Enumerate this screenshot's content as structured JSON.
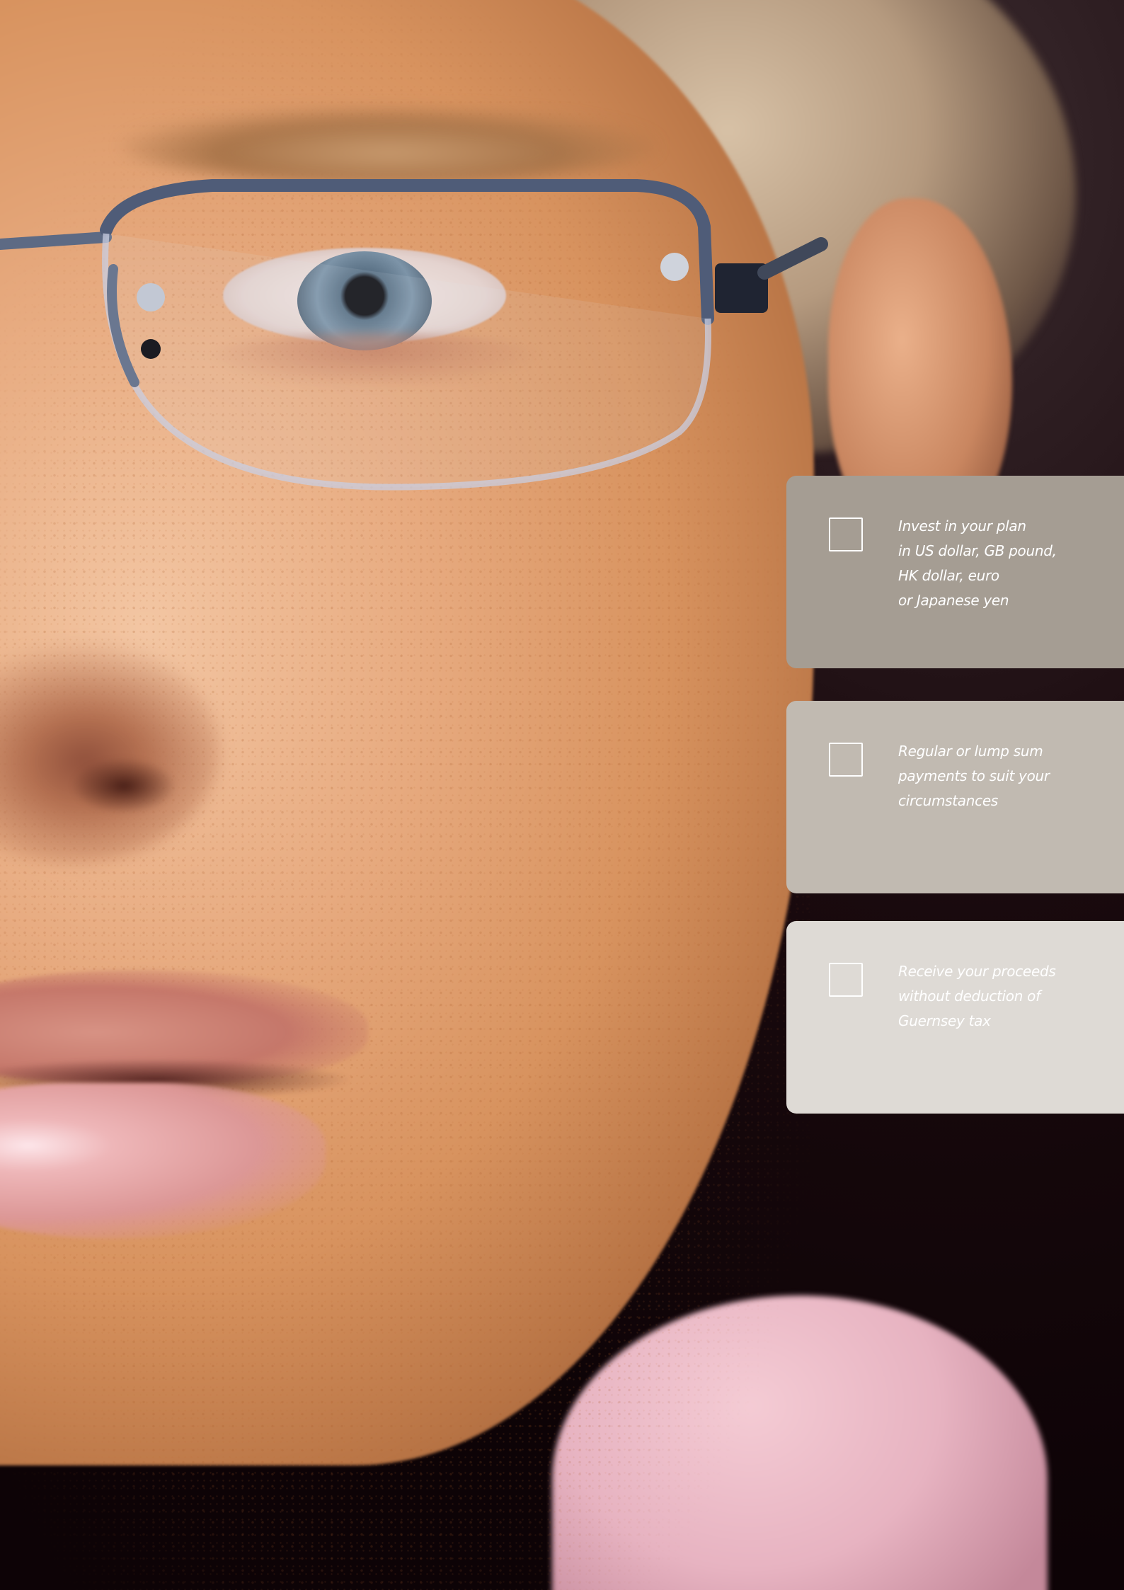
{
  "background": {
    "photo": "portrait-closeup-man-glasses",
    "colors": {
      "skin": "#e7aa7f",
      "backdrop": "#120508",
      "shirt": "#e7b3c1"
    }
  },
  "features": [
    {
      "checked": false,
      "color": "#a59d93",
      "lines": [
        "Invest in your plan",
        "in US dollar, GB pound,",
        "HK dollar, euro",
        "or Japanese yen"
      ]
    },
    {
      "checked": false,
      "color": "#c1bab1",
      "lines": [
        "Regular or lump sum",
        "payments to suit your",
        "circumstances"
      ]
    },
    {
      "checked": false,
      "color": "#dedad5",
      "lines": [
        "Receive your proceeds",
        "without deduction of",
        "Guernsey tax"
      ]
    }
  ]
}
